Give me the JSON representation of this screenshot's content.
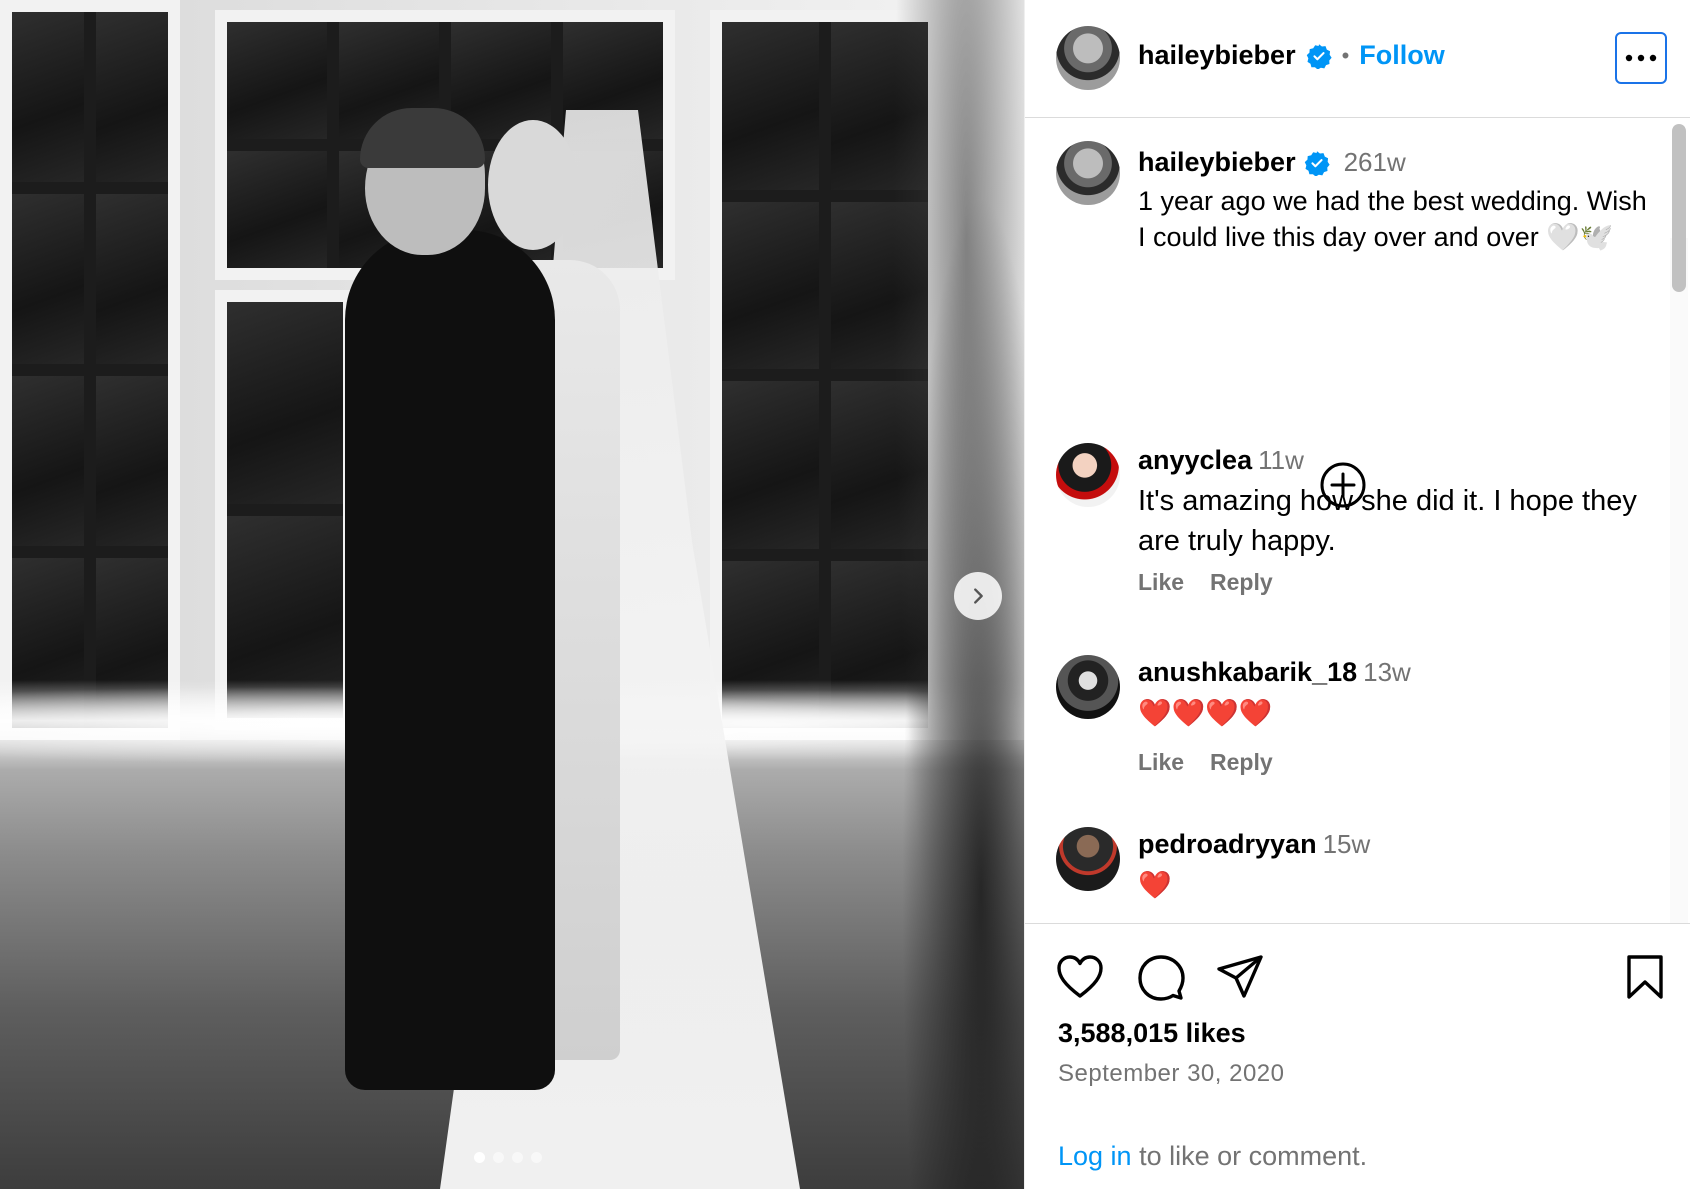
{
  "header": {
    "username": "haileybieber",
    "separator": "•",
    "follow_label": "Follow",
    "more_icon": "ellipsis-icon"
  },
  "caption": {
    "username": "haileybieber",
    "time": "261w",
    "text": "1 year ago we had the best wedding. Wish I could live this day over and over 🤍🕊️"
  },
  "comments": [
    {
      "username": "anyyclea",
      "time": "11w",
      "text": "It's amazing how she did it. I hope they are truly happy.",
      "like_label": "Like",
      "reply_label": "Reply"
    },
    {
      "username": "anushkabarik_18",
      "time": "13w",
      "text": "❤️❤️❤️❤️",
      "like_label": "Like",
      "reply_label": "Reply"
    },
    {
      "username": "pedroadryyan",
      "time": "15w",
      "text": "❤️"
    }
  ],
  "post": {
    "likes": "3,588,015 likes",
    "date": "September 30, 2020",
    "login_link": "Log in",
    "login_suffix": " to like or comment."
  },
  "carousel": {
    "slide_count": 4,
    "active_slide": 1
  },
  "colors": {
    "accent": "#0095f6",
    "verified": "#0095f6",
    "muted": "#737373"
  }
}
